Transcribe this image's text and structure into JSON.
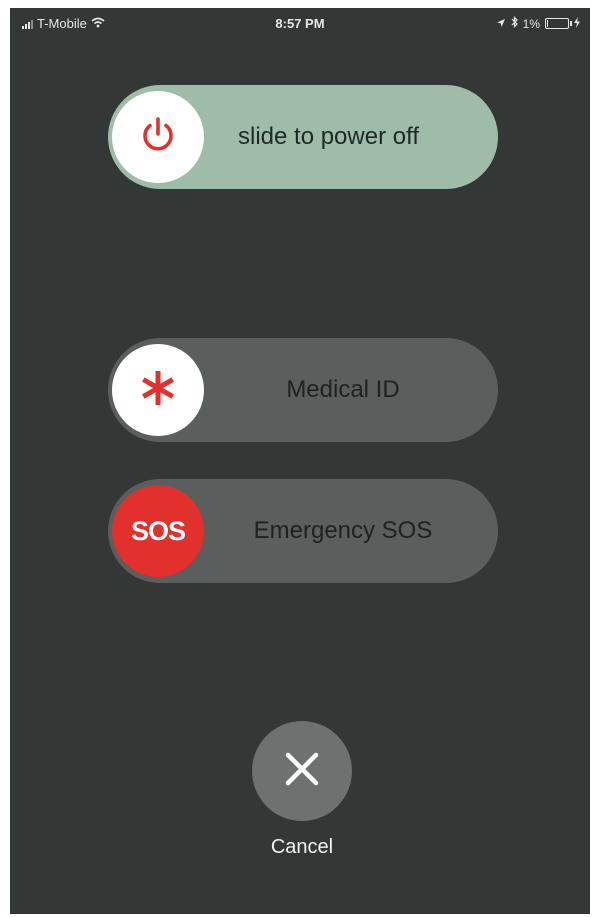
{
  "status_bar": {
    "carrier": "T-Mobile",
    "time": "8:57 PM",
    "battery_percent": "1%",
    "battery_level": 0.01,
    "icons": [
      "signal-icon",
      "wifi-icon",
      "location-icon",
      "bluetooth-icon",
      "battery-icon",
      "charging-icon"
    ]
  },
  "power_off": {
    "label": "slide to power off",
    "icon": "power-icon",
    "track_color": "#9fbca9",
    "icon_color": "#e2302d"
  },
  "medical_id": {
    "label": "Medical ID",
    "icon": "asterisk-icon",
    "icon_color": "#e2302d"
  },
  "emergency_sos": {
    "label": "Emergency SOS",
    "knob_text": "SOS",
    "knob_color": "#e2302d"
  },
  "cancel": {
    "label": "Cancel",
    "icon": "close-icon"
  },
  "colors": {
    "background": "#333836",
    "slider_track": "#5a5e5c",
    "cancel_circle": "#6e7170"
  }
}
